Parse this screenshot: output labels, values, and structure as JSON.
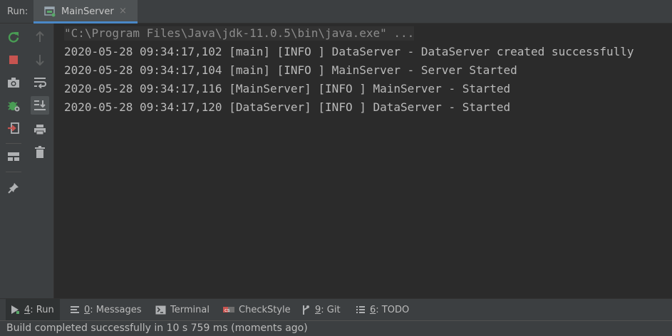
{
  "run_bar": {
    "label": "Run:",
    "tab": {
      "title": "MainServer",
      "close_glyph": "×",
      "icon": "run-config-icon"
    }
  },
  "left_toolbar": {
    "buttons": [
      {
        "name": "rerun",
        "icon": "rerun-icon"
      },
      {
        "name": "stop",
        "icon": "stop-icon"
      },
      {
        "name": "dump-threads",
        "icon": "camera-icon"
      },
      {
        "name": "debug-settings",
        "icon": "bug-icon"
      },
      {
        "name": "exit",
        "icon": "exit-icon"
      },
      {
        "name": "layout",
        "icon": "layout-icon"
      },
      {
        "name": "pin",
        "icon": "pin-icon"
      }
    ]
  },
  "second_toolbar": {
    "buttons": [
      {
        "name": "up",
        "icon": "arrow-up-icon"
      },
      {
        "name": "down",
        "icon": "arrow-down-icon"
      },
      {
        "name": "soft-wrap",
        "icon": "soft-wrap-icon"
      },
      {
        "name": "scroll-to-end",
        "icon": "scroll-to-end-icon",
        "active": true
      },
      {
        "name": "print",
        "icon": "print-icon"
      },
      {
        "name": "clear",
        "icon": "trash-icon"
      }
    ]
  },
  "console": {
    "lines": [
      "\"C:\\Program Files\\Java\\jdk-11.0.5\\bin\\java.exe\" ...",
      "2020-05-28 09:34:17,102 [main] [INFO ] DataServer - DataServer created successfully",
      "2020-05-28 09:34:17,104 [main] [INFO ] MainServer - Server Started",
      "2020-05-28 09:34:17,116 [MainServer] [INFO ] MainServer - Started",
      "2020-05-28 09:34:17,120 [DataServer] [INFO ] DataServer - Started"
    ]
  },
  "tool_windows": [
    {
      "key": "4",
      "label": ": Run",
      "icon": "play-icon",
      "active": true
    },
    {
      "key": "0",
      "label": ": Messages",
      "icon": "messages-icon"
    },
    {
      "key": "",
      "label": "Terminal",
      "icon": "terminal-icon"
    },
    {
      "key": "",
      "label": "CheckStyle",
      "icon": "checkstyle-icon"
    },
    {
      "key": "9",
      "label": ": Git",
      "icon": "git-icon"
    },
    {
      "key": "6",
      "label": ": TODO",
      "icon": "todo-icon"
    }
  ],
  "status_bar": {
    "text": "Build completed successfully in 10 s 759 ms (moments ago)"
  },
  "colors": {
    "background": "#2b2b2b",
    "panel": "#3c3f41",
    "accent": "#4a88c7",
    "rerun_green": "#499c54",
    "stop_red": "#c75450"
  }
}
